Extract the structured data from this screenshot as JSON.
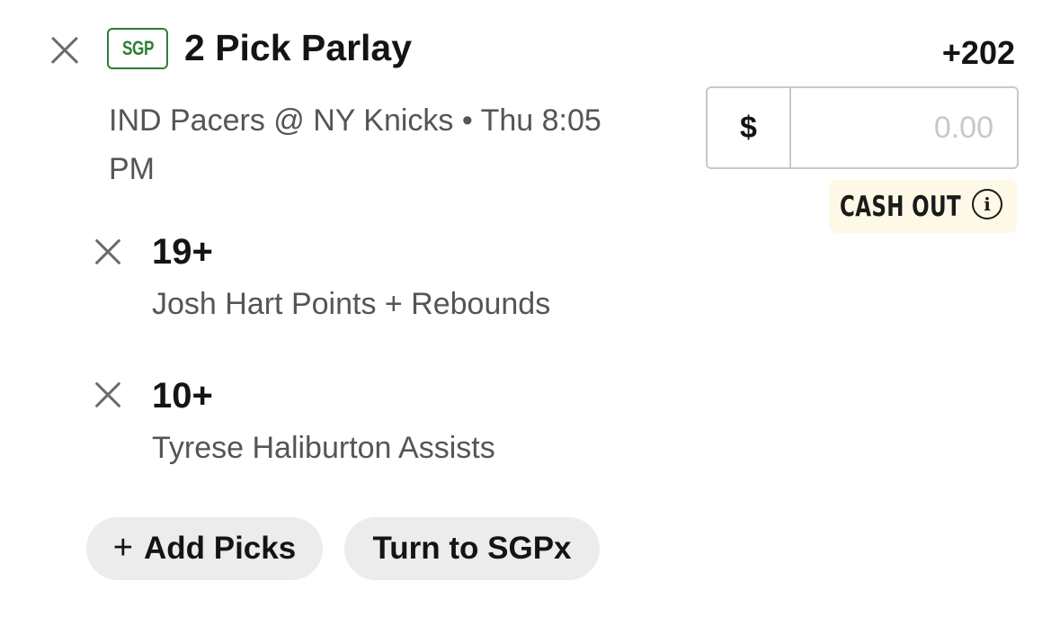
{
  "bet": {
    "badge": "SGP",
    "title": "2 Pick Parlay",
    "odds": "+202",
    "game": "IND Pacers @ NY Knicks • Thu 8:05 PM"
  },
  "wager": {
    "currency": "$",
    "placeholder": "0.00",
    "value": ""
  },
  "cash_out": {
    "label": "CASH OUT",
    "icon": "info-icon",
    "background": "#fdf9e6"
  },
  "legs": [
    {
      "line": "19+",
      "description": "Josh Hart Points + Rebounds"
    },
    {
      "line": "10+",
      "description": "Tyrese Haliburton Assists"
    }
  ],
  "actions": {
    "add_picks_icon": "+",
    "add_picks_label": "Add Picks",
    "sgpx_label": "Turn to SGPx"
  },
  "colors": {
    "sgp_green": "#2e7d32",
    "pill_bg": "#ececec",
    "muted_text": "#555555"
  }
}
